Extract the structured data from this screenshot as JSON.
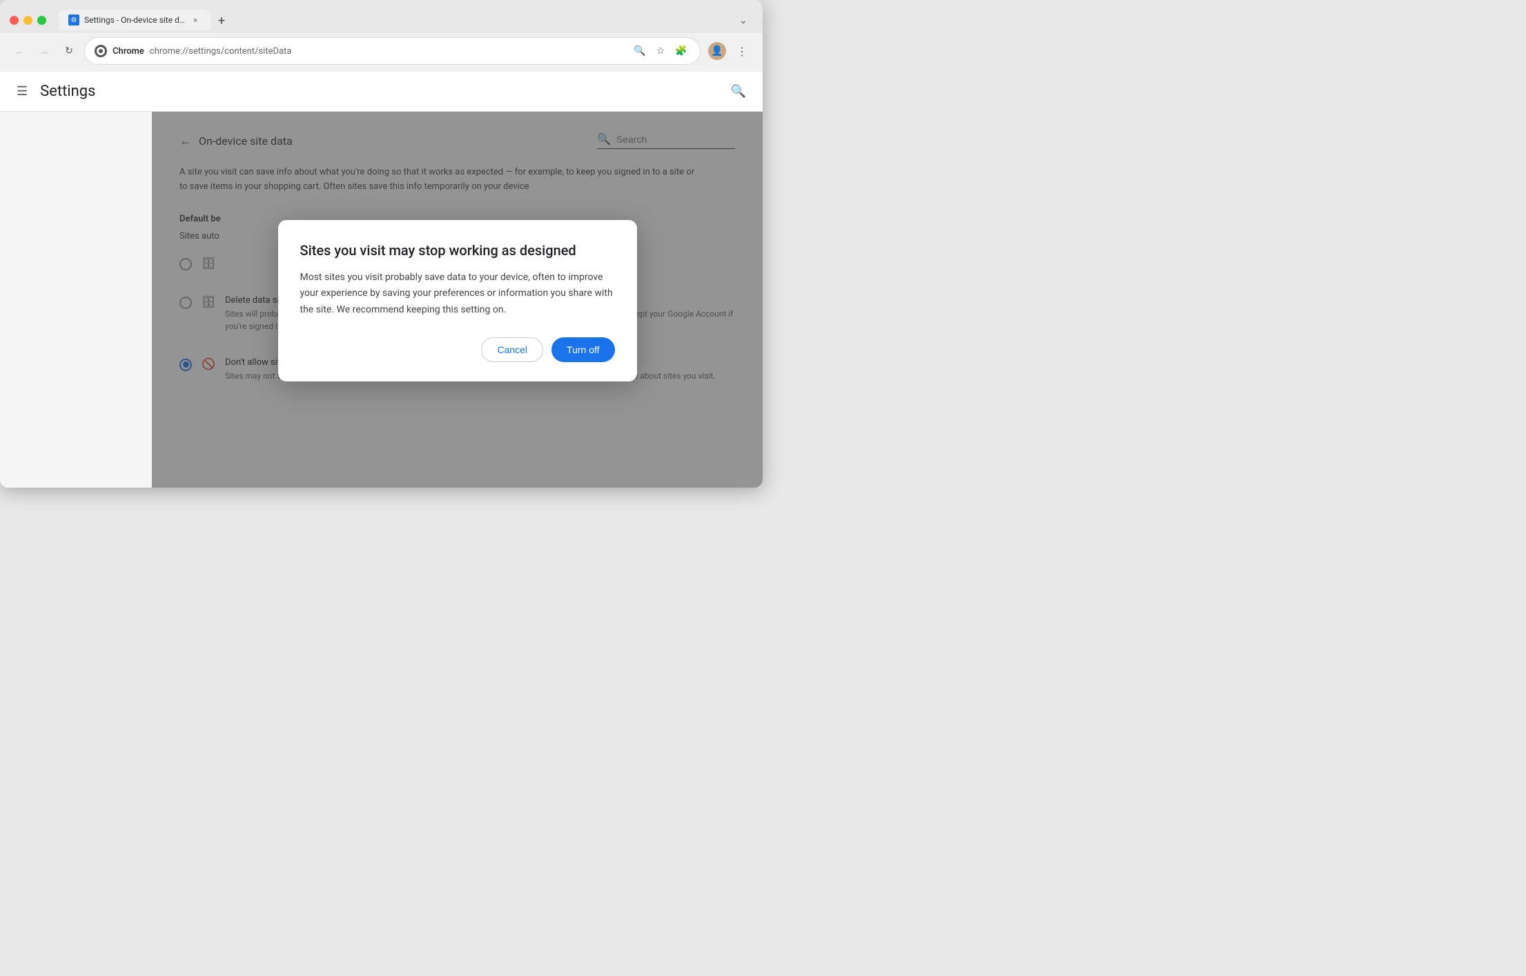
{
  "browser": {
    "tab": {
      "favicon_label": "⚙",
      "title": "Settings - On-device site dat",
      "close_label": "×"
    },
    "new_tab_label": "+",
    "dropdown_label": "⌄",
    "nav": {
      "back_label": "←",
      "forward_label": "→",
      "reload_label": "↻"
    },
    "url_bar": {
      "site_name": "Chrome",
      "url": "chrome://settings/content/siteData"
    },
    "url_icons": {
      "zoom_label": "🔍",
      "star_label": "☆",
      "extensions_label": "🧩"
    },
    "toolbar": {
      "menu_label": "⋮"
    }
  },
  "settings": {
    "header": {
      "hamburger_label": "☰",
      "title": "Settings",
      "search_icon_label": "🔍"
    },
    "page": {
      "back_label": "←",
      "page_title": "On-device site data",
      "search_placeholder": "Search"
    },
    "description": "A site you visit can save info about what you're doing so that it works as expected — for example, to keep you signed in to a site or to save items in your shopping cart. Often sites save this info temporarily on your device",
    "section_label": "Default be",
    "sites_auto_label": "Sites auto",
    "radio_options": [
      {
        "id": "option1",
        "selected": false,
        "icon": "🗄",
        "title": "",
        "desc": ""
      },
      {
        "id": "option2",
        "selected": false,
        "icon": "🗄",
        "title": "Delete data sites have saved to your device when you close all windows",
        "desc": "Sites will probably work as expected. You'll be signed out of most sites when you close all Chrome windows, except your Google Account if you're signed in to Chrome."
      },
      {
        "id": "option3",
        "selected": true,
        "icon": "🚫",
        "title": "Don't allow sites to save data on your device (not recommended)",
        "desc": "Sites may not work as you would expect. Choose this option if you don't want to leave information on your device about sites you visit."
      }
    ]
  },
  "dialog": {
    "title": "Sites you visit may stop working as designed",
    "body": "Most sites you visit probably save data to your device, often to improve your experience by saving your preferences or information you share with the site. We recommend keeping this setting on.",
    "cancel_label": "Cancel",
    "confirm_label": "Turn off"
  }
}
